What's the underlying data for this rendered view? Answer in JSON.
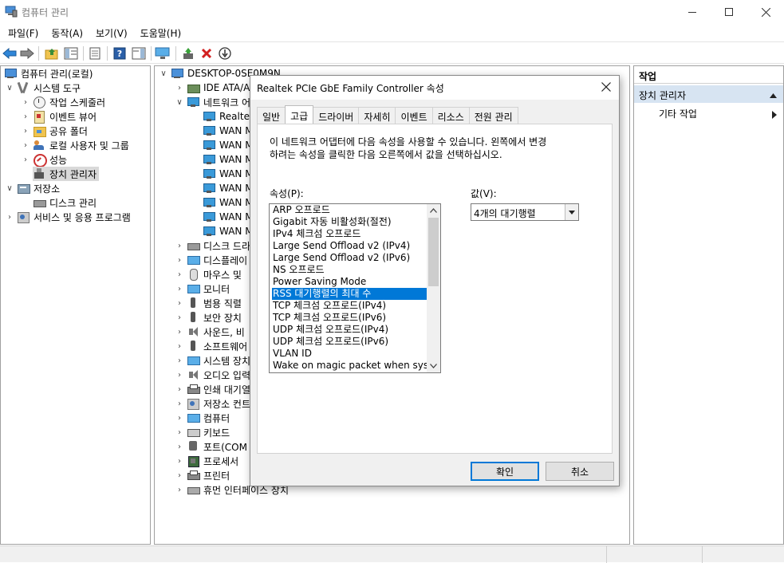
{
  "window": {
    "title": "컴퓨터 관리"
  },
  "menu": [
    "파일(F)",
    "동작(A)",
    "보기(V)",
    "도움말(H)"
  ],
  "tree": {
    "root": "컴퓨터 관리(로컬)",
    "system_tools": "시스템 도구",
    "task_scheduler": "작업 스케줄러",
    "event_viewer": "이벤트 뷰어",
    "shared_folders": "공유 폴더",
    "local_users": "로컬 사용자 및 그룹",
    "performance": "성능",
    "device_manager": "장치 관리자",
    "storage": "저장소",
    "disk_management": "디스크 관리",
    "services_apps": "서비스 및 응용 프로그램"
  },
  "devices": {
    "computer": "DESKTOP-0SE0M9N",
    "items": [
      "IDE ATA/A",
      "네트워크 어",
      "Realtek",
      "WAN M",
      "WAN M",
      "WAN M",
      "WAN M",
      "WAN M",
      "WAN M",
      "WAN M",
      "WAN M",
      "디스크 드라",
      "디스플레이",
      "마우스 및",
      "모니터",
      "범용 직렬",
      "보안 장치",
      "사운드, 비",
      "소프트웨어",
      "시스템 장치",
      "오디오 입력",
      "인쇄 대기열",
      "저장소 컨트",
      "컴퓨터",
      "키보드",
      "포트(COM",
      "프로세서",
      "프린터",
      "휴먼 인터페이스 장치"
    ]
  },
  "actions": {
    "header": "작업",
    "section": "장치 관리자",
    "more": "기타 작업"
  },
  "dialog": {
    "title": "Realtek PCIe GbE Family Controller 속성",
    "tabs": [
      "일반",
      "고급",
      "드라이버",
      "자세히",
      "이벤트",
      "리소스",
      "전원 관리"
    ],
    "active_tab": "고급",
    "description_line1": "이 네트워크 어댑터에 다음 속성을 사용할 수 있습니다. 왼쪽에서 변경",
    "description_line2": "하려는 속성을 클릭한 다음 오른쪽에서 값을 선택하십시오.",
    "property_label": "속성(P):",
    "value_label": "값(V):",
    "properties": [
      "ARP 오프로드",
      "Gigabit 자동 비활성화(절전)",
      "IPv4 체크섬 오프로드",
      "Large Send Offload v2 (IPv4)",
      "Large Send Offload v2 (IPv6)",
      "NS 오프로드",
      "Power Saving Mode",
      "RSS 대기행렬의 최대 수",
      "TCP 체크섬 오프로드(IPv4)",
      "TCP 체크섬 오프로드(IPv6)",
      "UDP 체크섬 오프로드(IPv4)",
      "UDP 체크섬 오프로드(IPv6)",
      "VLAN ID",
      "Wake on magic packet when system"
    ],
    "selected_property": "RSS 대기행렬의 최대 수",
    "value": "4개의 대기행렬",
    "ok": "확인",
    "cancel": "취소"
  },
  "colors": {
    "selection": "#0078d7",
    "action_section": "#d7e4f2"
  }
}
